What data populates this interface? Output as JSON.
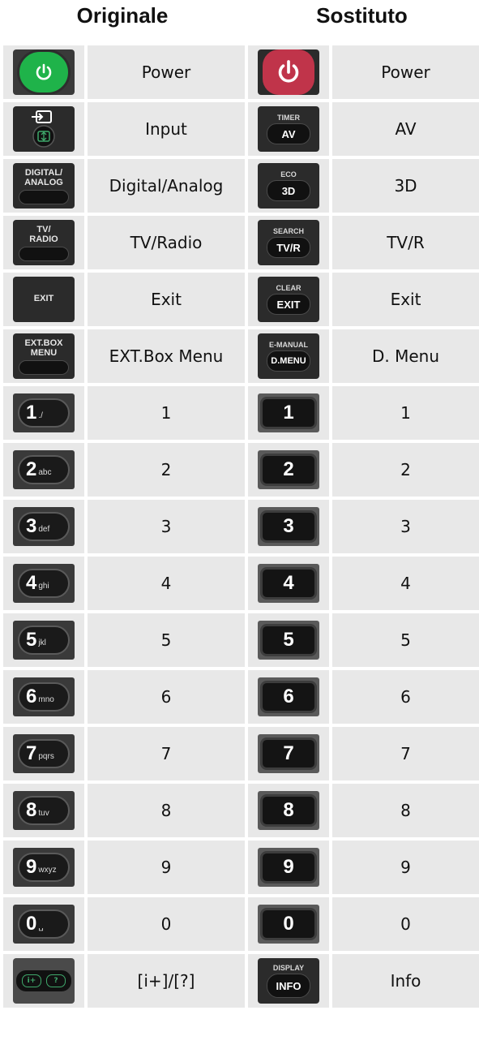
{
  "header": {
    "left": "Originale",
    "right": "Sostituto"
  },
  "rows": [
    {
      "orig_label": "Power",
      "sub_label": "Power"
    },
    {
      "orig_label": "Input",
      "sub_label": "AV",
      "sub_top": "TIMER",
      "sub_pill": "AV"
    },
    {
      "orig_label": "Digital/Analog",
      "orig_btn": "DIGITAL/\nANALOG",
      "sub_label": "3D",
      "sub_top": "ECO",
      "sub_pill": "3D"
    },
    {
      "orig_label": "TV/Radio",
      "orig_btn": "TV/\nRADIO",
      "sub_label": "TV/R",
      "sub_top": "SEARCH",
      "sub_pill": "TV/R"
    },
    {
      "orig_label": "Exit",
      "orig_btn": "EXIT",
      "sub_label": "Exit",
      "sub_top": "CLEAR",
      "sub_pill": "EXIT"
    },
    {
      "orig_label": "EXT.Box Menu",
      "orig_btn": "EXT.BOX\nMENU",
      "sub_label": "D. Menu",
      "sub_top": "E-MANUAL",
      "sub_pill": "D.MENU"
    },
    {
      "orig_label": "1",
      "digit": "1",
      "sub": "./",
      "sub_label": "1"
    },
    {
      "orig_label": "2",
      "digit": "2",
      "sub": "abc",
      "sub_label": "2"
    },
    {
      "orig_label": "3",
      "digit": "3",
      "sub": "def",
      "sub_label": "3"
    },
    {
      "orig_label": "4",
      "digit": "4",
      "sub": "ghi",
      "sub_label": "4"
    },
    {
      "orig_label": "5",
      "digit": "5",
      "sub": "jkl",
      "sub_label": "5"
    },
    {
      "orig_label": "6",
      "digit": "6",
      "sub": "mno",
      "sub_label": "6"
    },
    {
      "orig_label": "7",
      "digit": "7",
      "sub": "pqrs",
      "sub_label": "7"
    },
    {
      "orig_label": "8",
      "digit": "8",
      "sub": "tuv",
      "sub_label": "8"
    },
    {
      "orig_label": "9",
      "digit": "9",
      "sub": "wxyz",
      "sub_label": "9"
    },
    {
      "orig_label": "0",
      "digit": "0",
      "sub": "␣",
      "sub_label": "0"
    },
    {
      "orig_label": "[i+]/[?]",
      "sub_label": "Info",
      "sub_top": "DISPLAY",
      "sub_pill": "INFO"
    }
  ],
  "colors": {
    "cell_bg": "#e8e8e8",
    "power_orig": "#1fb34a",
    "power_sub": "#c0344a"
  },
  "icons": {
    "power": "power-icon",
    "input": "input-source-icon",
    "info": "info-icon",
    "help": "help-icon"
  }
}
